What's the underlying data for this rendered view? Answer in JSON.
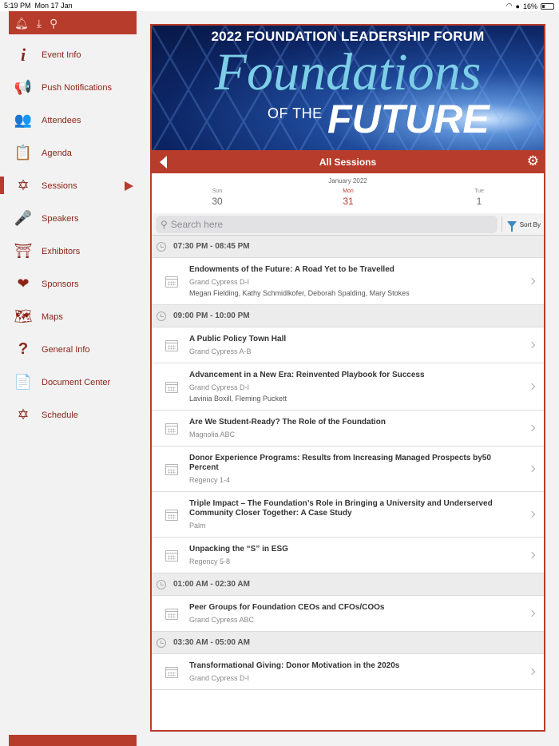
{
  "status_bar": {
    "time": "5:19 PM",
    "date": "Mon 17 Jan",
    "battery": "16%"
  },
  "sidebar": {
    "items": [
      {
        "label": "Event Info",
        "icon": "info-icon",
        "glyph": "i"
      },
      {
        "label": "Push Notifications",
        "icon": "megaphone-icon",
        "glyph": "📢"
      },
      {
        "label": "Attendees",
        "icon": "people-icon",
        "glyph": "👥"
      },
      {
        "label": "Agenda",
        "icon": "agenda-icon",
        "glyph": "📋"
      },
      {
        "label": "Sessions",
        "icon": "star-of-david-icon",
        "glyph": "✡",
        "active": true
      },
      {
        "label": "Speakers",
        "icon": "microphone-icon",
        "glyph": "🎤"
      },
      {
        "label": "Exhibitors",
        "icon": "booth-icon",
        "glyph": "⛩"
      },
      {
        "label": "Sponsors",
        "icon": "handshake-heart-icon",
        "glyph": "❤"
      },
      {
        "label": "Maps",
        "icon": "map-icon",
        "glyph": "🗺"
      },
      {
        "label": "General Info",
        "icon": "question-icon",
        "glyph": "?"
      },
      {
        "label": "Document Center",
        "icon": "document-icon",
        "glyph": "📄"
      },
      {
        "label": "Schedule",
        "icon": "star-of-david-icon",
        "glyph": "✡"
      }
    ]
  },
  "banner": {
    "top_line": "2022 FOUNDATION LEADERSHIP FORUM",
    "big": "Foundations",
    "of_the": "OF THE",
    "future": "FUTURE"
  },
  "nav": {
    "title": "All  Sessions"
  },
  "dates": {
    "month": "January 2022",
    "days": [
      {
        "name": "Sun",
        "num": "30"
      },
      {
        "name": "Mon",
        "num": "31",
        "active": true
      },
      {
        "name": "Tue",
        "num": "1"
      }
    ]
  },
  "search": {
    "placeholder": "Search here",
    "sort_label": "Sort By"
  },
  "groups": [
    {
      "time": "07:30 PM - 08:45 PM",
      "sessions": [
        {
          "title": "Endowments of the Future:  A Road Yet to be Travelled",
          "location": "Grand Cypress D-I",
          "speakers": "Megan Fielding, Kathy Schmidlkofer, Deborah Spalding, Mary Stokes"
        }
      ]
    },
    {
      "time": "09:00 PM - 10:00 PM",
      "sessions": [
        {
          "title": "A Public Policy Town Hall",
          "location": "Grand Cypress A-B",
          "speakers": ""
        },
        {
          "title": "Advancement in a New Era: Reinvented Playbook for Success",
          "location": "Grand Cypress D-I",
          "speakers": "Lavinia Boxill, Fleming Puckett"
        },
        {
          "title": "Are We Student-Ready? The Role of the Foundation",
          "location": "Magnolia ABC",
          "speakers": ""
        },
        {
          "title": "Donor Experience Programs: Results from Increasing Managed Prospects by50 Percent",
          "location": "Regency 1-4",
          "speakers": ""
        },
        {
          "title": "Triple Impact – The Foundation’s Role in Bringing a University and Underserved Community Closer Together: A Case Study",
          "location": "Palm",
          "speakers": ""
        },
        {
          "title": "Unpacking the “S” in ESG",
          "location": "Regency 5-8",
          "speakers": ""
        }
      ]
    },
    {
      "time": "01:00 AM - 02:30 AM",
      "sessions": [
        {
          "title": "Peer Groups for Foundation CEOs and CFOs/COOs",
          "location": "Grand Cypress ABC",
          "speakers": ""
        }
      ]
    },
    {
      "time": "03:30 AM - 05:00 AM",
      "sessions": [
        {
          "title": "Transformational Giving: Donor Motivation in the 2020s",
          "location": "Grand Cypress D-I",
          "speakers": ""
        }
      ]
    }
  ]
}
